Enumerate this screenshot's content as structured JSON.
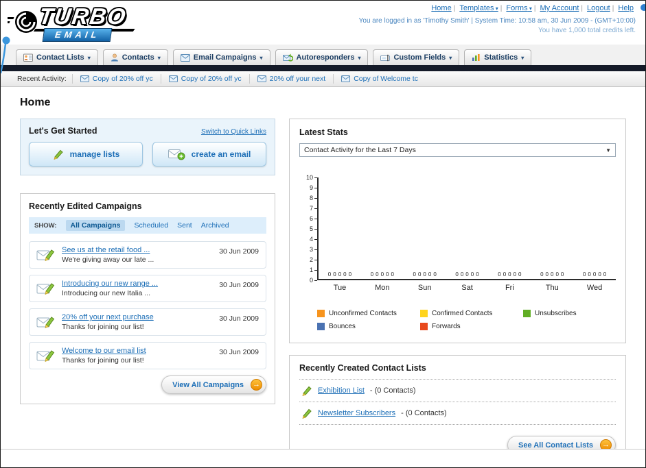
{
  "brand": {
    "logo_main": "TURBO",
    "logo_sub": "EMAIL"
  },
  "top_nav": {
    "separator": "|",
    "links": [
      {
        "label": "Home",
        "dropdown": false
      },
      {
        "label": "Templates",
        "dropdown": true
      },
      {
        "label": "Forms",
        "dropdown": true
      },
      {
        "label": "My Account",
        "dropdown": false
      },
      {
        "label": "Logout",
        "dropdown": false
      },
      {
        "label": "Help",
        "dropdown": false
      }
    ],
    "login_info": "You are logged in as 'Timothy Smith' | System Time: 10:58 am, 30 Jun 2009 - (GMT+10:00)",
    "credits_info": "You have 1,000 total credits left."
  },
  "main_tabs": [
    {
      "label": "Contact Lists"
    },
    {
      "label": "Contacts"
    },
    {
      "label": "Email Campaigns"
    },
    {
      "label": "Autoresponders"
    },
    {
      "label": "Custom Fields"
    },
    {
      "label": "Statistics"
    }
  ],
  "recent_activity": {
    "label": "Recent Activity:",
    "items": [
      {
        "label": "Copy of 20% off yc"
      },
      {
        "label": "Copy of 20% off yc"
      },
      {
        "label": "20% off your next"
      },
      {
        "label": "Copy of Welcome tc"
      }
    ]
  },
  "page": {
    "title": "Home"
  },
  "get_started": {
    "title": "Let's Get Started",
    "switch_link": "Switch to Quick Links",
    "manage_lists_label": "manage lists",
    "create_email_label": "create an email"
  },
  "campaigns": {
    "title": "Recently Edited Campaigns",
    "show_label": "SHOW:",
    "filters": [
      {
        "label": "All Campaigns",
        "active": true
      },
      {
        "label": "Scheduled",
        "active": false
      },
      {
        "label": "Sent",
        "active": false
      },
      {
        "label": "Archived",
        "active": false
      }
    ],
    "items": [
      {
        "title": "See us at the retail food ...",
        "subtitle": "We're giving away our late ...",
        "date": "30 Jun 2009"
      },
      {
        "title": "Introducing our new range ...",
        "subtitle": "Introducing our new Italia ...",
        "date": "30 Jun 2009"
      },
      {
        "title": "20% off your next purchase",
        "subtitle": "Thanks for joining our list!",
        "date": "30 Jun 2009"
      },
      {
        "title": "Welcome to our email list",
        "subtitle": "Thanks for joining our list!",
        "date": "30 Jun 2009"
      }
    ],
    "view_all_label": "View All Campaigns"
  },
  "latest_stats": {
    "title": "Latest Stats",
    "dropdown_value": "Contact Activity for the Last 7 Days"
  },
  "chart_data": {
    "type": "bar",
    "title": "Contact Activity for the Last 7 Days",
    "categories": [
      "Tue",
      "Mon",
      "Sun",
      "Sat",
      "Fri",
      "Thu",
      "Wed"
    ],
    "series": [
      {
        "name": "Unconfirmed Contacts",
        "color": "#f7941d",
        "values": [
          0,
          0,
          0,
          0,
          0,
          0,
          0
        ]
      },
      {
        "name": "Confirmed Contacts",
        "color": "#ffd41e",
        "values": [
          0,
          0,
          0,
          0,
          0,
          0,
          0
        ]
      },
      {
        "name": "Unsubscribes",
        "color": "#61ae24",
        "values": [
          0,
          0,
          0,
          0,
          0,
          0,
          0
        ]
      },
      {
        "name": "Bounces",
        "color": "#4a72b2",
        "values": [
          0,
          0,
          0,
          0,
          0,
          0,
          0
        ]
      },
      {
        "name": "Forwards",
        "color": "#e8491d",
        "values": [
          0,
          0,
          0,
          0,
          0,
          0,
          0
        ]
      }
    ],
    "ylim": [
      0,
      10
    ],
    "yticks": [
      0,
      1,
      2,
      3,
      4,
      5,
      6,
      7,
      8,
      9,
      10
    ],
    "legend_position": "bottom",
    "grid": false
  },
  "contact_lists": {
    "title": "Recently Created Contact Lists",
    "items": [
      {
        "name": "Exhibition List",
        "detail": "- (0 Contacts)"
      },
      {
        "name": "Newsletter Subscribers",
        "detail": "- (0 Contacts)"
      }
    ],
    "see_all_label": "See All Contact Lists"
  }
}
